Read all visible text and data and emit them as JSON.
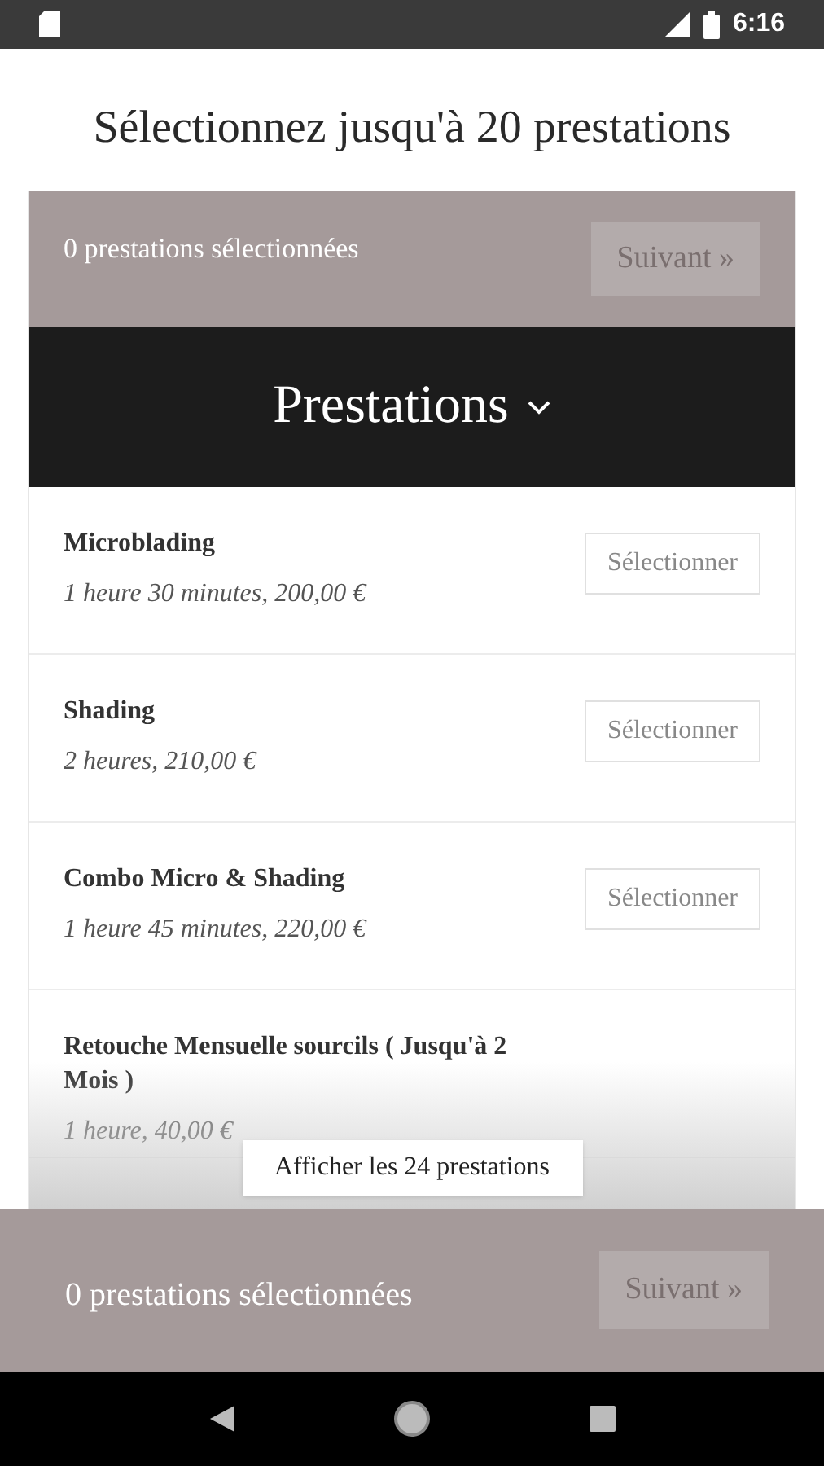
{
  "status_bar": {
    "time": "6:16"
  },
  "title": "Sélectionnez jusqu'à 20 prestations",
  "top_bar": {
    "count": "0 prestations sélectionnées",
    "next_button": {
      "label": "Suivant",
      "chevron": "»",
      "disabled": true
    }
  },
  "section": {
    "title": "Prestations",
    "expanded": true
  },
  "services": [
    {
      "name": "Microblading",
      "details": "1 heure 30 minutes, 200,00 €",
      "button": "Sélectionner"
    },
    {
      "name": "Shading",
      "details": "2 heures, 210,00 €",
      "button": "Sélectionner"
    },
    {
      "name": "Combo Micro & Shading",
      "details": "1 heure 45 minutes, 220,00 €",
      "button": "Sélectionner"
    },
    {
      "name": "Retouche Mensuelle sourcils ( Jusqu'à 2 Mois )",
      "details": "1 heure, 40,00 €"
    }
  ],
  "show_all_button": "Afficher les 24 prestations",
  "bottom_bar": {
    "count": "0 prestations sélectionnées",
    "next_button": {
      "label": "Suivant",
      "chevron": "»",
      "disabled": true
    }
  }
}
